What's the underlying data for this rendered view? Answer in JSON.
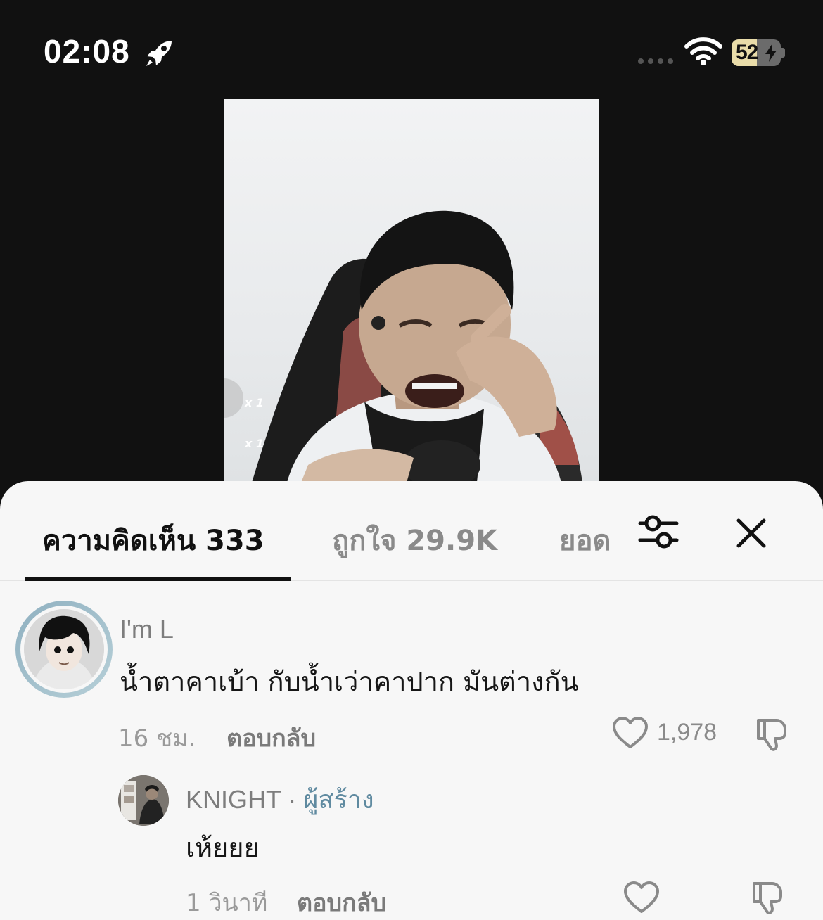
{
  "status_bar": {
    "time": "02:08",
    "battery_level": "52",
    "battery_fraction": 0.52
  },
  "video": {
    "gift_counts": [
      "x 1",
      "x 1"
    ]
  },
  "tabs": {
    "comments": "ความคิดเห็น 333",
    "likes": "ถูกใจ 29.9K",
    "views": "ยอด"
  },
  "comments": [
    {
      "username": "I'm L",
      "text": "น้ำตาคาเบ้า กับน้ำเว่าคาปาก มันต่างกัน",
      "time": "16 ชม.",
      "reply_label": "ตอบกลับ",
      "likes": "1,978"
    },
    {
      "username": "KNIGHT",
      "separator": "·",
      "badge": "ผู้สร้าง",
      "text": "เห้ยยย",
      "time": "1 วินาที",
      "reply_label": "ตอบกลับ",
      "likes": ""
    }
  ],
  "icons": {
    "status": [
      "rocket-icon",
      "signal-dots-icon",
      "wifi-icon",
      "battery-icon"
    ],
    "header": [
      "filter-icon",
      "close-icon"
    ],
    "comment_actions": [
      "heart-icon",
      "dislike-icon"
    ]
  },
  "colors": {
    "background": "#111111",
    "sheet": "#f7f7f7",
    "active_tab": "#111111",
    "inactive_tab": "#8a8a8a",
    "creator_badge": "#5f8aa0"
  }
}
